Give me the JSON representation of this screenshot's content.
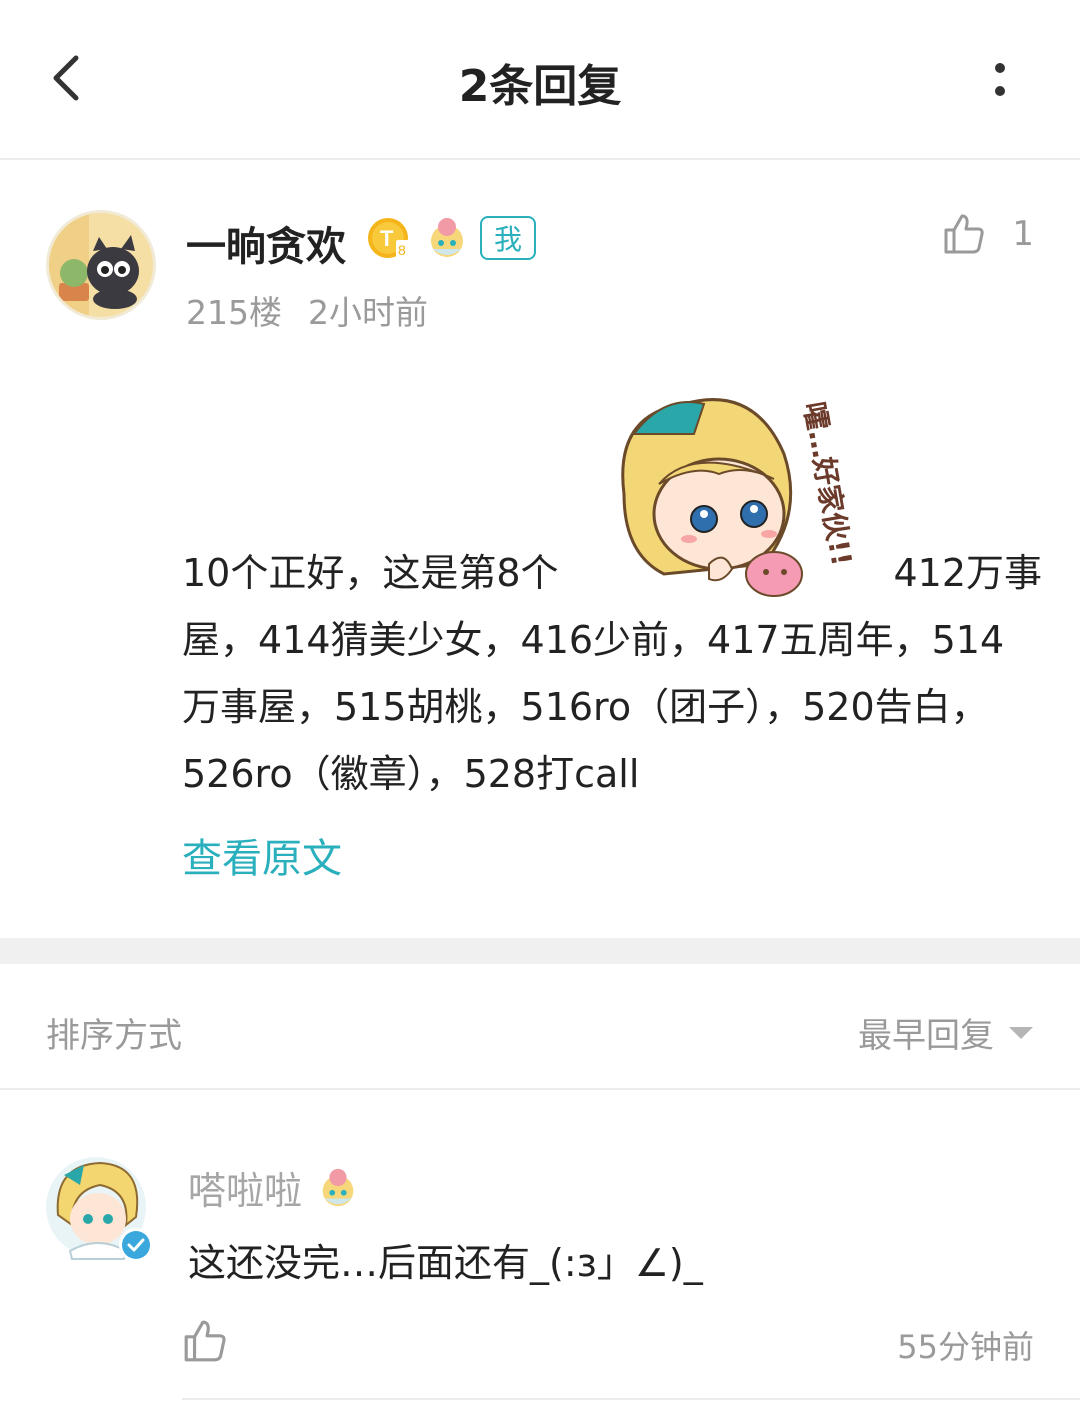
{
  "header": {
    "title": "2条回复",
    "back_icon": "chevron-left-icon",
    "more_icon": "more-vertical-icon"
  },
  "post": {
    "username": "一晌贪欢",
    "level_badge": "T8",
    "me_tag": "我",
    "floor": "215楼",
    "time": "2小时前",
    "like_count": "1",
    "content_line1_a": "10个正好，这是第8个",
    "content_line1_b": "412万事",
    "content_rest": "屋，414猜美少女，416少前，417五周年，514万事屋，515胡桃，516ro（团子），520告白，526ro（徽章），528打call",
    "sticker_text": "嚯…好家伙!!",
    "view_original": "查看原文"
  },
  "sort": {
    "label": "排序方式",
    "selected": "最早回复"
  },
  "reply": {
    "username": "嗒啦啦",
    "text": "这还没完…后面还有_(:з」∠)_",
    "time": "55分钟前"
  },
  "colors": {
    "accent": "#2ab0bd",
    "muted": "#9a9a9a",
    "text": "#222222",
    "divider": "#f0f0f0"
  }
}
